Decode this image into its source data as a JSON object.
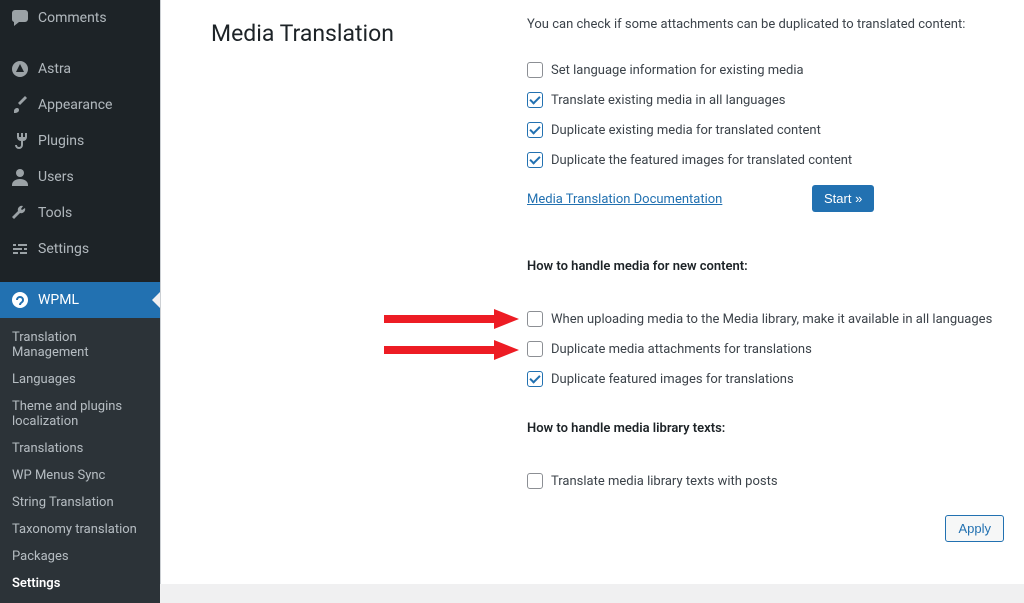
{
  "sidebar": {
    "items": [
      {
        "label": "Comments",
        "icon": "comments"
      },
      {
        "label": "Astra",
        "icon": "astra"
      },
      {
        "label": "Appearance",
        "icon": "appearance"
      },
      {
        "label": "Plugins",
        "icon": "plugin"
      },
      {
        "label": "Users",
        "icon": "user"
      },
      {
        "label": "Tools",
        "icon": "tools"
      },
      {
        "label": "Settings",
        "icon": "settings"
      }
    ],
    "active": {
      "label": "WPML",
      "icon": "wpml"
    },
    "submenu": [
      "Translation Management",
      "Languages",
      "Theme and plugins localization",
      "Translations",
      "WP Menus Sync",
      "String Translation",
      "Taxonomy translation",
      "Packages",
      "Settings"
    ],
    "submenu_current_index": 8
  },
  "page": {
    "title": "Media Translation",
    "intro": "You can check if some attachments can be duplicated to translated content:",
    "checks_existing": [
      {
        "label": "Set language information for existing media",
        "checked": false
      },
      {
        "label": "Translate existing media in all languages",
        "checked": true
      },
      {
        "label": "Duplicate existing media for translated content",
        "checked": true
      },
      {
        "label": "Duplicate the featured images for translated content",
        "checked": true
      }
    ],
    "doc_link_label": "Media Translation Documentation",
    "start_button": "Start »",
    "heading_new": "How to handle media for new content:",
    "checks_new": [
      {
        "label": "When uploading media to the Media library, make it available in all languages",
        "checked": false
      },
      {
        "label": "Duplicate media attachments for translations",
        "checked": false
      },
      {
        "label": "Duplicate featured images for translations",
        "checked": true
      }
    ],
    "heading_texts": "How to handle media library texts:",
    "checks_texts": [
      {
        "label": "Translate media library texts with posts",
        "checked": false
      }
    ],
    "apply_button": "Apply"
  }
}
